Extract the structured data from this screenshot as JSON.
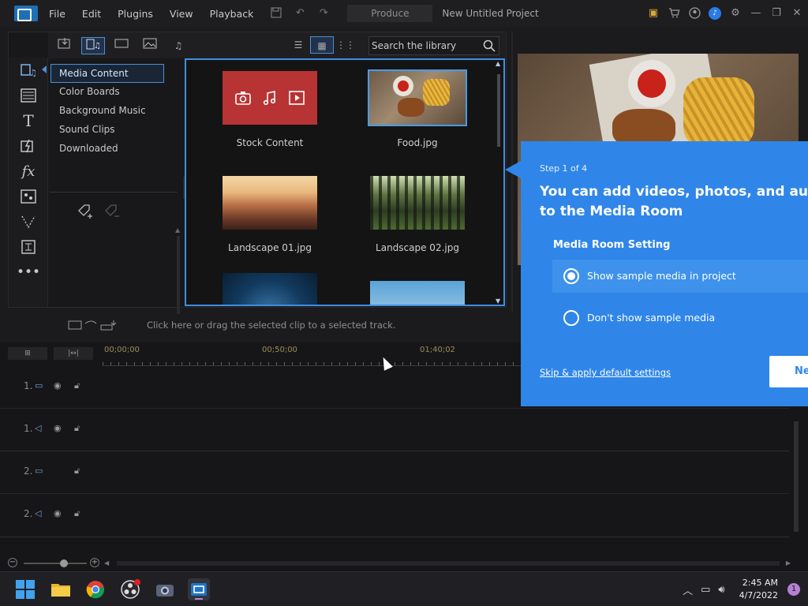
{
  "menu": {
    "items": [
      "File",
      "Edit",
      "Plugins",
      "View",
      "Playback"
    ],
    "produce_label": "Produce",
    "project_title": "New Untitled Project"
  },
  "library": {
    "search_placeholder": "Search the library",
    "categories": [
      "Media Content",
      "Color Boards",
      "Background Music",
      "Sound Clips",
      "Downloaded"
    ],
    "tiles": [
      {
        "label": "Stock Content"
      },
      {
        "label": "Food.jpg"
      },
      {
        "label": "Landscape 01.jpg"
      },
      {
        "label": "Landscape 02.jpg"
      }
    ]
  },
  "instruction": {
    "text": "Click here or drag the selected clip to a selected track."
  },
  "timeline": {
    "ruler_marks": [
      "00;00;00",
      "00;50;00",
      "01;40;02"
    ],
    "tracks": [
      {
        "num": "1.",
        "icon": "video-track-icon"
      },
      {
        "num": "1.",
        "icon": "audio-track-icon"
      },
      {
        "num": "2.",
        "icon": "video-track-icon"
      },
      {
        "num": "2.",
        "icon": "audio-track-icon"
      }
    ]
  },
  "tour": {
    "step": "Step 1 of 4",
    "title_line1": "You can add videos, photos, and audio",
    "title_line2": "to the Media Room",
    "setting_label": "Media Room Setting",
    "option1": "Show sample media in project",
    "option2": "Don't show sample media",
    "skip_label": "Skip & apply default settings",
    "next_label": "Next"
  },
  "taskbar": {
    "time": "2:45 AM",
    "date": "4/7/2022",
    "notification_count": "1"
  },
  "colors": {
    "accent": "#2f86e8",
    "selection_border": "#4b8fd6",
    "stock_tile": "#b83333"
  }
}
